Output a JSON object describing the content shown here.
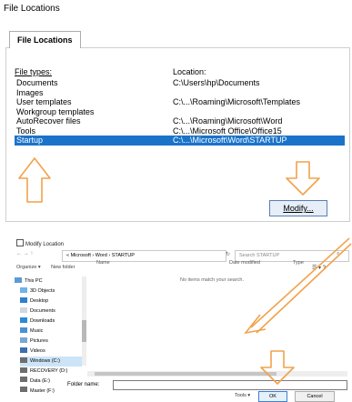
{
  "dialog": {
    "title": "File Locations",
    "tab_label": "File Locations",
    "file_types_header": "File types:",
    "location_header": "Location:",
    "rows": [
      {
        "type": "Documents",
        "location": "C:\\Users\\hp\\Documents"
      },
      {
        "type": "Images",
        "location": ""
      },
      {
        "type": "User templates",
        "location": "C:\\...\\Roaming\\Microsoft\\Templates"
      },
      {
        "type": "Workgroup templates",
        "location": ""
      },
      {
        "type": "AutoRecover files",
        "location": "C:\\...\\Roaming\\Microsoft\\Word"
      },
      {
        "type": "Tools",
        "location": "C:\\...\\Microsoft Office\\Office15"
      },
      {
        "type": "Startup",
        "location": "C:\\...\\Microsoft\\Word\\STARTUP"
      }
    ],
    "selected_row": "Startup",
    "modify_label": "Modify...",
    "selection_color": "#1a73c9"
  },
  "modify_dialog": {
    "title": "Modify Location",
    "address": "« Microsoft › Word › STARTUP",
    "search_placeholder": "Search STARTUP",
    "toolbar_organize": "Organize ▾",
    "toolbar_new_folder": "New folder",
    "columns": [
      "Name",
      "Date modified",
      "Type"
    ],
    "empty_message": "No items match your search.",
    "nav_items": [
      {
        "label": "This PC",
        "icon": "computer-icon"
      },
      {
        "label": "3D Objects",
        "icon": "cube-icon"
      },
      {
        "label": "Desktop",
        "icon": "desktop-icon"
      },
      {
        "label": "Documents",
        "icon": "document-icon"
      },
      {
        "label": "Downloads",
        "icon": "download-icon"
      },
      {
        "label": "Music",
        "icon": "music-icon"
      },
      {
        "label": "Pictures",
        "icon": "picture-icon"
      },
      {
        "label": "Videos",
        "icon": "video-icon"
      },
      {
        "label": "Windows (C:)",
        "icon": "drive-icon"
      },
      {
        "label": "RECOVERY (D:)",
        "icon": "drive-icon"
      },
      {
        "label": "Data (E:)",
        "icon": "drive-icon"
      },
      {
        "label": "Master (F:)",
        "icon": "drive-icon"
      }
    ],
    "selected_nav": "Windows (C:)",
    "folder_name_label": "Folder name:",
    "folder_name_value": "",
    "tools_label": "Tools ▾",
    "ok_label": "OK",
    "cancel_label": "Cancel"
  },
  "annotations": {
    "arrow_color": "#f2a24a",
    "icons": [
      "up-arrow-annotation-icon",
      "down-arrow-annotation-icon",
      "pointer-line-annotation-icon"
    ]
  }
}
